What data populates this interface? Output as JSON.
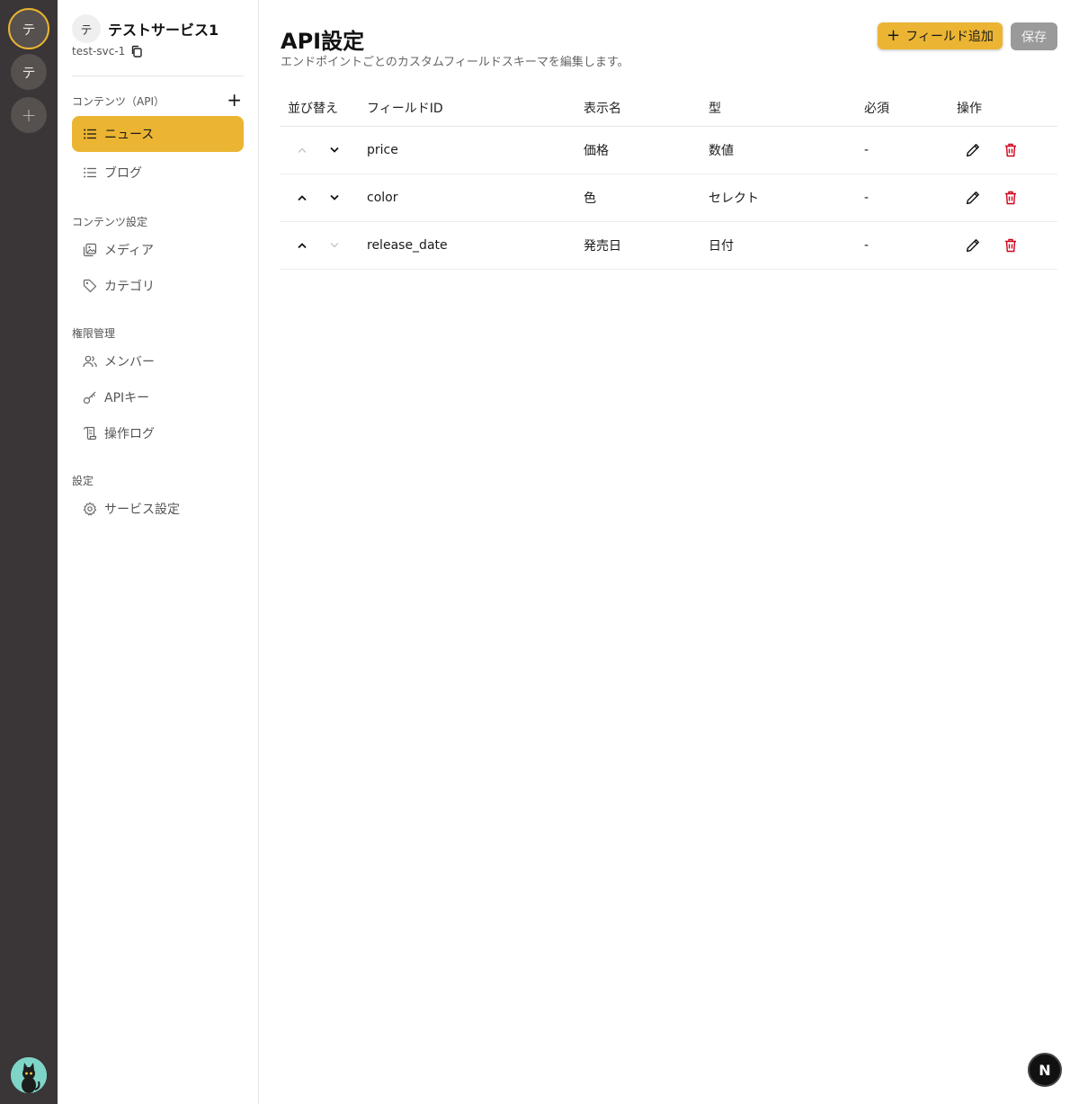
{
  "rail": {
    "services": [
      {
        "initial": "テ",
        "active": true
      },
      {
        "initial": "テ",
        "active": false
      }
    ],
    "add_label": "+"
  },
  "sidebar": {
    "service_initial": "テ",
    "service_name": "テストサービス1",
    "service_id": "test-svc-1",
    "content_api_label": "コンテンツ（API）",
    "content_api_add": "+",
    "apis": [
      {
        "label": "ニュース",
        "icon": "list-icon",
        "active": true
      },
      {
        "label": "ブログ",
        "icon": "list-icon",
        "active": false
      }
    ],
    "content_settings_label": "コンテンツ設定",
    "content_settings": [
      {
        "label": "メディア",
        "icon": "media-icon"
      },
      {
        "label": "カテゴリ",
        "icon": "tag-icon"
      }
    ],
    "permissions_label": "権限管理",
    "permissions": [
      {
        "label": "メンバー",
        "icon": "users-icon"
      },
      {
        "label": "APIキー",
        "icon": "key-icon"
      },
      {
        "label": "操作ログ",
        "icon": "log-icon"
      }
    ],
    "settings_label": "設定",
    "settings": [
      {
        "label": "サービス設定",
        "icon": "gear-icon"
      }
    ]
  },
  "main": {
    "title": "API設定",
    "subtitle": "エンドポイントごとのカスタムフィールドスキーマを編集します。",
    "add_field_label": "フィールド追加",
    "save_label": "保存",
    "columns": [
      "並び替え",
      "フィールドID",
      "表示名",
      "型",
      "必須",
      "操作"
    ],
    "rows": [
      {
        "field_id": "price",
        "display_name": "価格",
        "type": "数値",
        "required": "-",
        "can_up": false,
        "can_down": true
      },
      {
        "field_id": "color",
        "display_name": "色",
        "type": "セレクト",
        "required": "-",
        "can_up": true,
        "can_down": true
      },
      {
        "field_id": "release_date",
        "display_name": "発売日",
        "type": "日付",
        "required": "-",
        "can_up": true,
        "can_down": false
      }
    ]
  },
  "colors": {
    "accent": "#ebb533",
    "rail_bg": "#3a3536",
    "delete": "#d0021b"
  },
  "badge": {
    "label": "N"
  }
}
